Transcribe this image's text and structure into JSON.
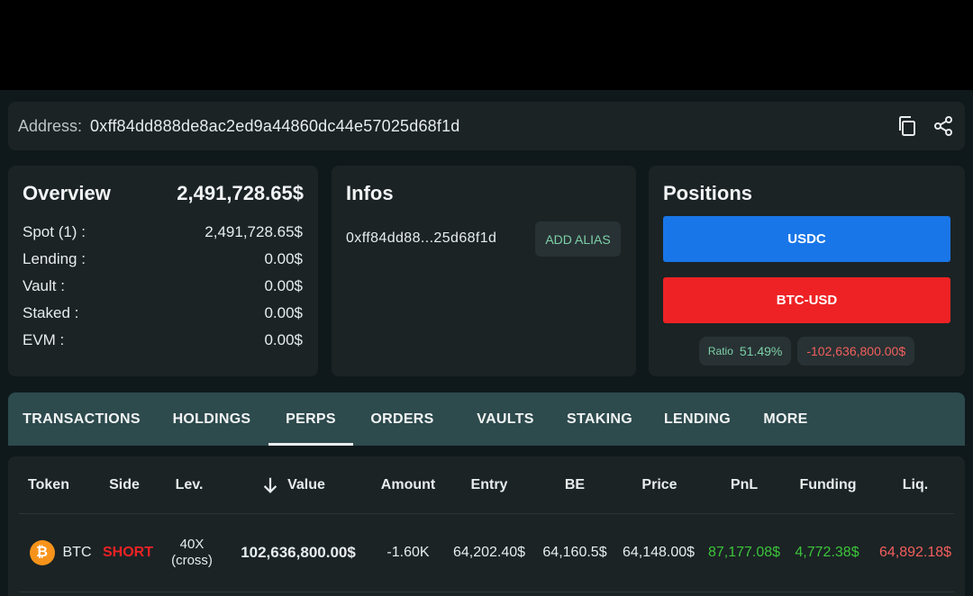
{
  "address": {
    "label": "Address:",
    "value": "0xff84dd888de8ac2ed9a44860dc44e57025d68f1d",
    "copy_icon": "copy-icon",
    "share_icon": "share-icon"
  },
  "overview": {
    "title": "Overview",
    "total": "2,491,728.65$",
    "rows": [
      {
        "label": "Spot (1) :",
        "value": "2,491,728.65$"
      },
      {
        "label": "Lending :",
        "value": "0.00$"
      },
      {
        "label": "Vault :",
        "value": "0.00$"
      },
      {
        "label": "Staked :",
        "value": "0.00$"
      },
      {
        "label": "EVM :",
        "value": "0.00$"
      }
    ]
  },
  "infos": {
    "title": "Infos",
    "short_address": "0xff84dd88...25d68f1d",
    "alias_button": "ADD ALIAS"
  },
  "positions": {
    "title": "Positions",
    "usdc_label": "USDC",
    "btc_label": "BTC-USD",
    "ratio_label": "Ratio",
    "ratio_value": "51.49%",
    "net_value": "-102,636,800.00$",
    "colors": {
      "usdc": "#1976e8",
      "btc": "#ee2224"
    }
  },
  "tabs": [
    {
      "label": "TRANSACTIONS"
    },
    {
      "label": "HOLDINGS"
    },
    {
      "label": "PERPS",
      "active": true
    },
    {
      "label": "ORDERS"
    },
    {
      "label": "VAULTS"
    },
    {
      "label": "STAKING"
    },
    {
      "label": "LENDING"
    },
    {
      "label": "MORE"
    }
  ],
  "table": {
    "headers": [
      "Token",
      "Side",
      "Lev.",
      "Value",
      "Amount",
      "Entry",
      "BE",
      "Price",
      "PnL",
      "Funding",
      "Liq."
    ],
    "sort_icon": "arrow-down-icon",
    "rows": [
      {
        "token": "BTC",
        "token_icon": "bitcoin-icon",
        "side": "SHORT",
        "lev": "40X",
        "lev_mode": "(cross)",
        "value": "102,636,800.00$",
        "amount": "-1.60K",
        "entry": "64,202.40$",
        "be": "64,160.5$",
        "price": "64,148.00$",
        "pnl": "87,177.08$",
        "funding": "4,772.38$",
        "liq": "64,892.18$"
      }
    ]
  }
}
